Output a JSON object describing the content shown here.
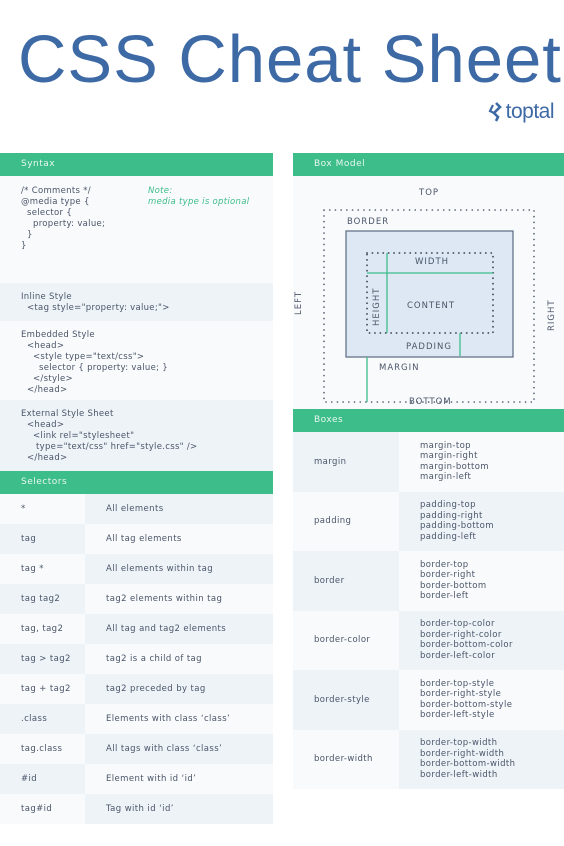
{
  "header": {
    "title": "CSS Cheat Sheet",
    "brand": "toptal",
    "brand_icon": "toptal-logo-icon"
  },
  "colors": {
    "title_blue": "#3d69a5",
    "section_green": "#3dbd8a",
    "row_light": "#f8fafc",
    "row_dark": "#eef3f8",
    "box_fill": "#dde8f4",
    "text": "#4a5568"
  },
  "syntax": {
    "heading": "Syntax",
    "block1_code": "/* Comments */\n@media type {\n  selector {\n    property: value;\n  }\n}",
    "block1_note": "Note:\nmedia type is optional",
    "block2_code": "Inline Style\n  <tag style=\"property: value;\">",
    "block3_code": "Embedded Style\n  <head>\n    <style type=\"text/css\">\n      selector { property: value; }\n    </style>\n  </head>",
    "block4_code": "External Style Sheet\n  <head>\n    <link rel=\"stylesheet\"\n     type=\"text/css\" href=\"style.css\" />\n  </head>"
  },
  "selectors": {
    "heading": "Selectors",
    "rows": [
      {
        "selector": "*",
        "description": "All elements"
      },
      {
        "selector": "tag",
        "description": "All tag elements"
      },
      {
        "selector": "tag *",
        "description": "All elements within tag"
      },
      {
        "selector": "tag tag2",
        "description": "tag2 elements within tag"
      },
      {
        "selector": "tag, tag2",
        "description": "All tag and tag2 elements"
      },
      {
        "selector": "tag > tag2",
        "description": "tag2 is a child of tag"
      },
      {
        "selector": "tag + tag2",
        "description": "tag2 preceded by tag"
      },
      {
        "selector": ".class",
        "description": "Elements with class ‘class’"
      },
      {
        "selector": "tag.class",
        "description": "All tags with class ‘class’"
      },
      {
        "selector": "#id",
        "description": "Element with id ‘id’"
      },
      {
        "selector": "tag#id",
        "description": "Tag with id ‘id’"
      }
    ]
  },
  "box_model": {
    "heading": "Box Model",
    "labels": {
      "top": "TOP",
      "bottom": "BOTTOM",
      "left": "LEFT",
      "right": "RIGHT",
      "border": "BORDER",
      "width": "WIDTH",
      "height": "HEIGHT",
      "content": "CONTENT",
      "padding": "PADDING",
      "margin": "MARGIN"
    }
  },
  "boxes": {
    "heading": "Boxes",
    "rows": [
      {
        "name": "margin",
        "props": [
          "margin-top",
          "margin-right",
          "margin-bottom",
          "margin-left"
        ]
      },
      {
        "name": "padding",
        "props": [
          "padding-top",
          "padding-right",
          "padding-bottom",
          "padding-left"
        ]
      },
      {
        "name": "border",
        "props": [
          "border-top",
          "border-right",
          "border-bottom",
          "border-left"
        ]
      },
      {
        "name": "border-color",
        "props": [
          "border-top-color",
          "border-right-color",
          "border-bottom-color",
          "border-left-color"
        ]
      },
      {
        "name": "border-style",
        "props": [
          "border-top-style",
          "border-right-style",
          "border-bottom-style",
          "border-left-style"
        ]
      },
      {
        "name": "border-width",
        "props": [
          "border-top-width",
          "border-right-width",
          "border-bottom-width",
          "border-left-width"
        ]
      }
    ]
  }
}
